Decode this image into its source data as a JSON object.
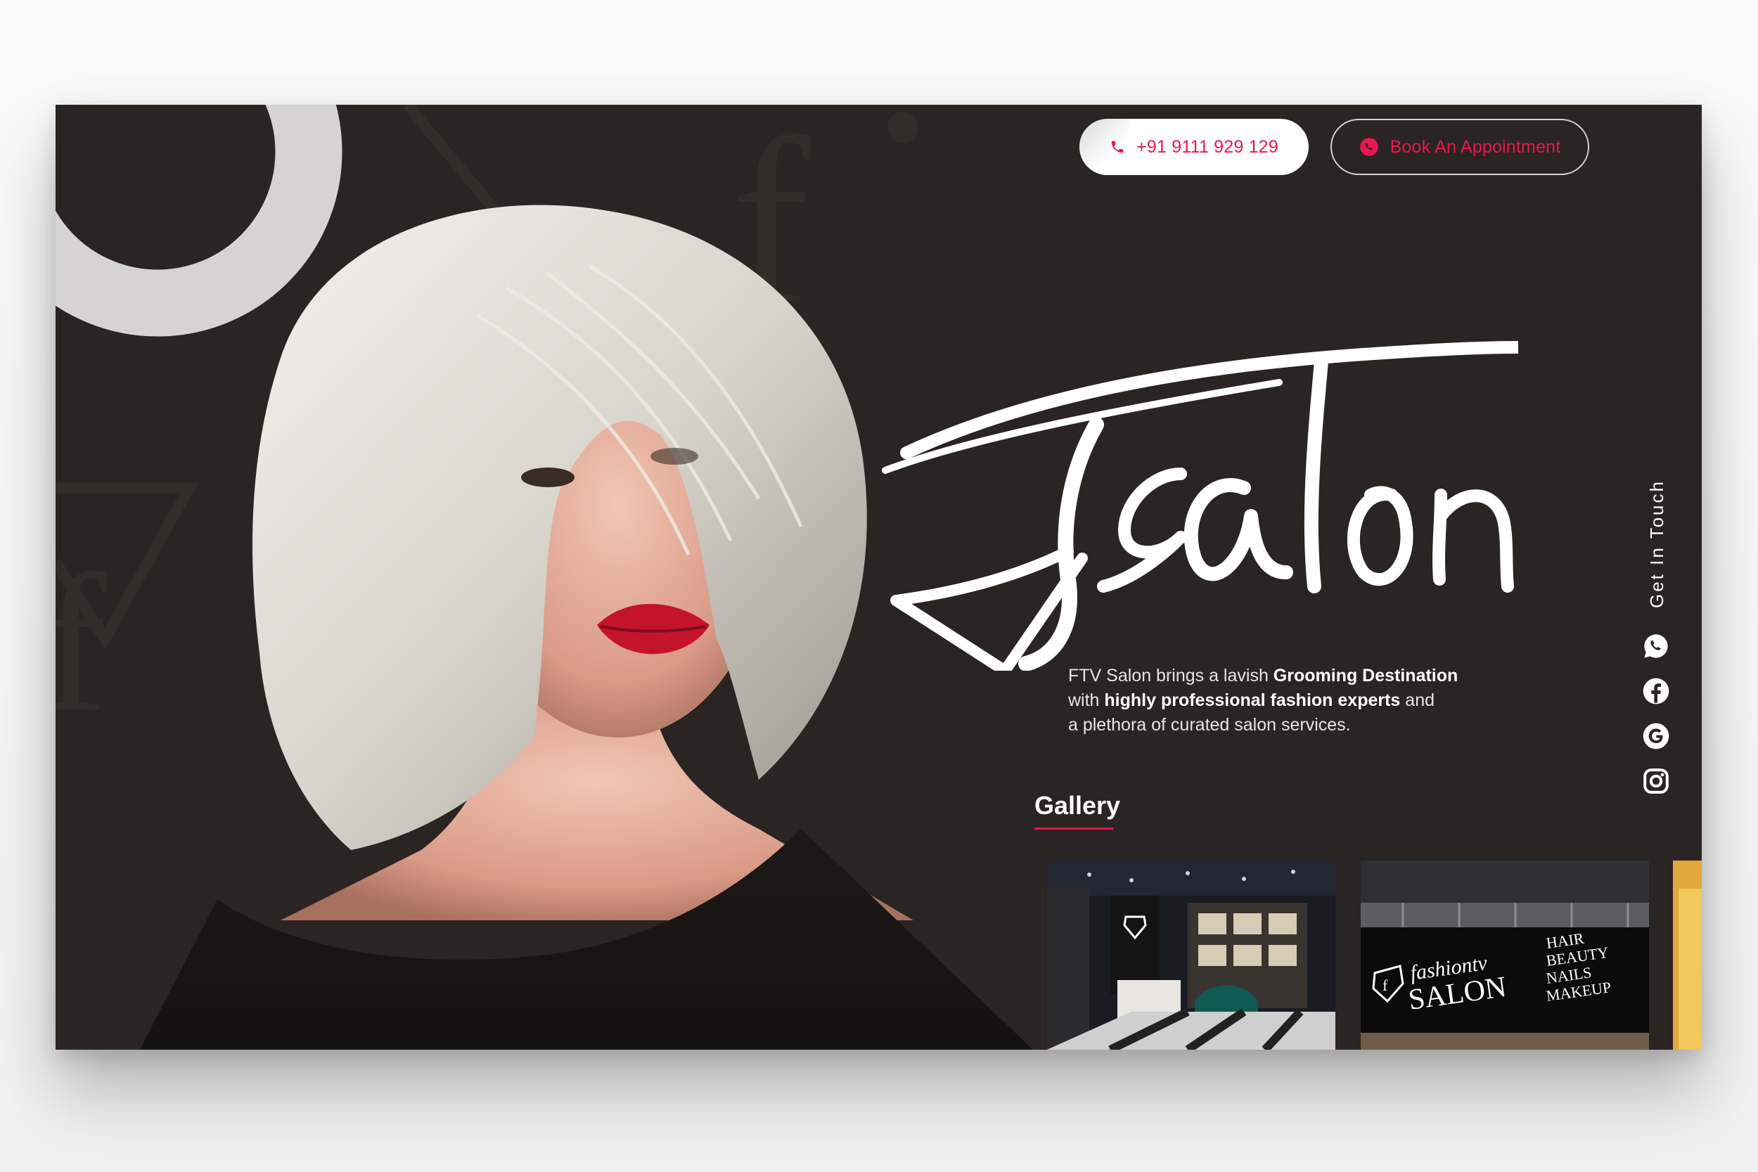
{
  "header": {
    "phone_label": "+91 9111 929 129",
    "book_label": "Book An Appointment"
  },
  "hero": {
    "brand_script": "Fsalon",
    "intro": {
      "t1": "FTV Salon brings a lavish ",
      "b1": "Grooming Destination",
      "t2": "with ",
      "b2": "highly professional fashion experts",
      "t3": " and",
      "t4": "a plethora of curated salon services."
    }
  },
  "gallery": {
    "title": "Gallery",
    "photo2": {
      "brand_line1": "fashiontv",
      "brand_line2": "SALON",
      "services": [
        "HAIR",
        "BEAUTY",
        "NAILS",
        "MAKEUP"
      ]
    }
  },
  "contact_rail": {
    "label": "Get In Touch",
    "icons": [
      "whatsapp-icon",
      "facebook-icon",
      "google-icon",
      "instagram-icon"
    ]
  },
  "colors": {
    "accent": "#e8174f",
    "background": "#2a2422",
    "text": "#ffffff"
  }
}
